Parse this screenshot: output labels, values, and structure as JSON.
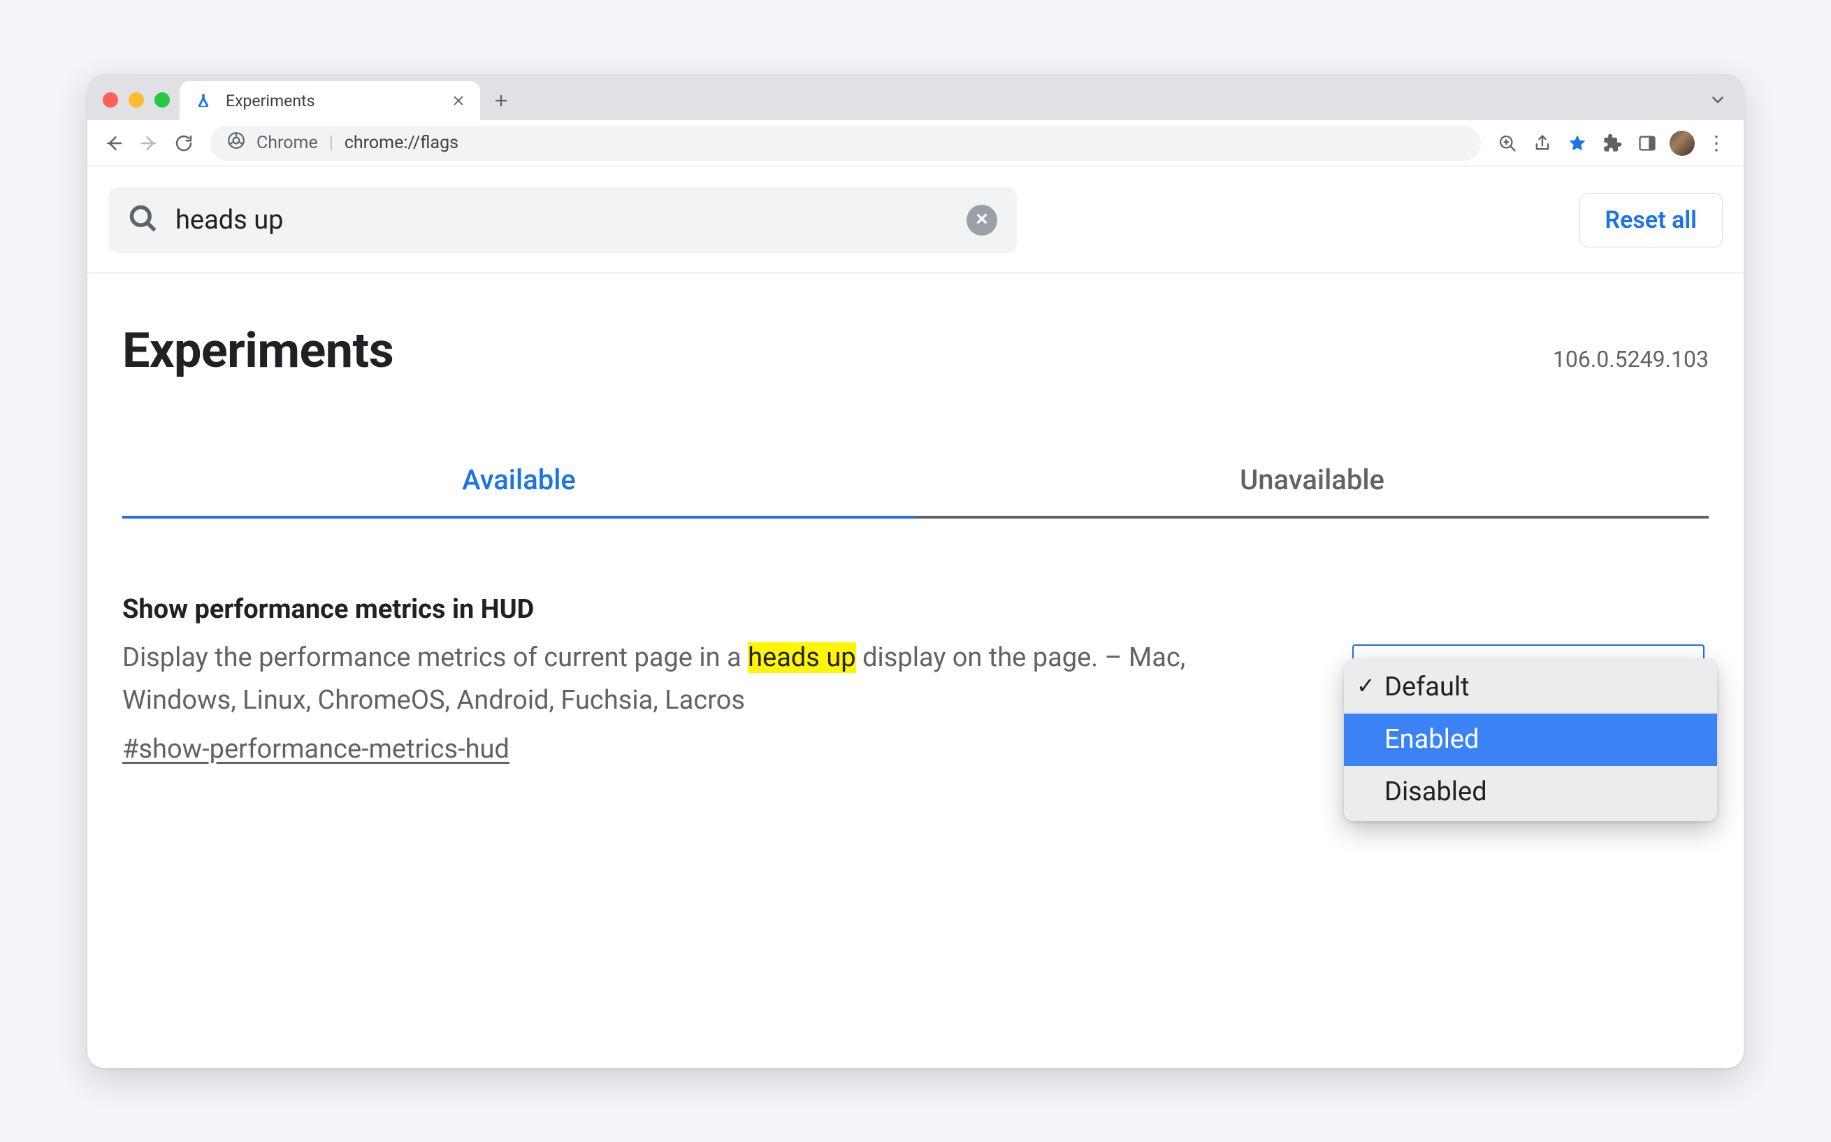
{
  "tabstrip": {
    "tabs": [
      {
        "title": "Experiments",
        "favicon": "flask"
      }
    ]
  },
  "omnibox": {
    "site_label": "Chrome",
    "path": "chrome://flags"
  },
  "search": {
    "query": "heads up"
  },
  "reset_label": "Reset all",
  "page_title": "Experiments",
  "version": "106.0.5249.103",
  "tabs": {
    "available": "Available",
    "unavailable": "Unavailable",
    "active": "available"
  },
  "flag": {
    "title": "Show performance metrics in HUD",
    "desc_before": "Display the performance metrics of current page in a ",
    "highlight": "heads up",
    "desc_after": " display on the page. – Mac, Windows, Linux, ChromeOS, Android, Fuchsia, Lacros",
    "hash": "#show-performance-metrics-hud",
    "options": {
      "default": "Default",
      "enabled": "Enabled",
      "disabled": "Disabled",
      "checked": "default",
      "hover": "enabled"
    }
  }
}
